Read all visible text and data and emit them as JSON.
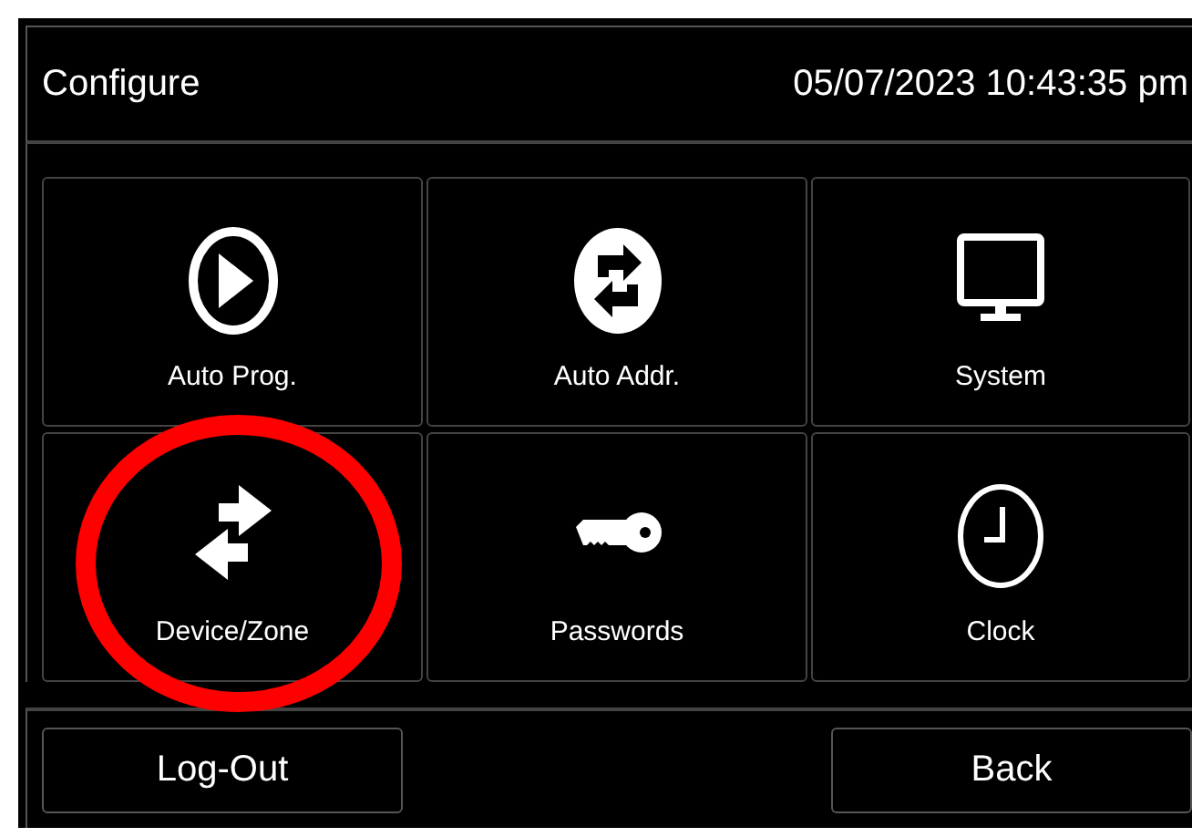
{
  "header": {
    "title": "Configure",
    "datetime": "05/07/2023 10:43:35 pm"
  },
  "tiles": [
    {
      "label": "Auto Prog.",
      "circled": false
    },
    {
      "label": "Auto Addr.",
      "circled": false
    },
    {
      "label": "System",
      "circled": false
    },
    {
      "label": "Device/Zone",
      "circled": true
    },
    {
      "label": "Passwords",
      "circled": false
    },
    {
      "label": "Clock",
      "circled": false
    }
  ],
  "buttons": [
    "Log-Out",
    "Back"
  ]
}
